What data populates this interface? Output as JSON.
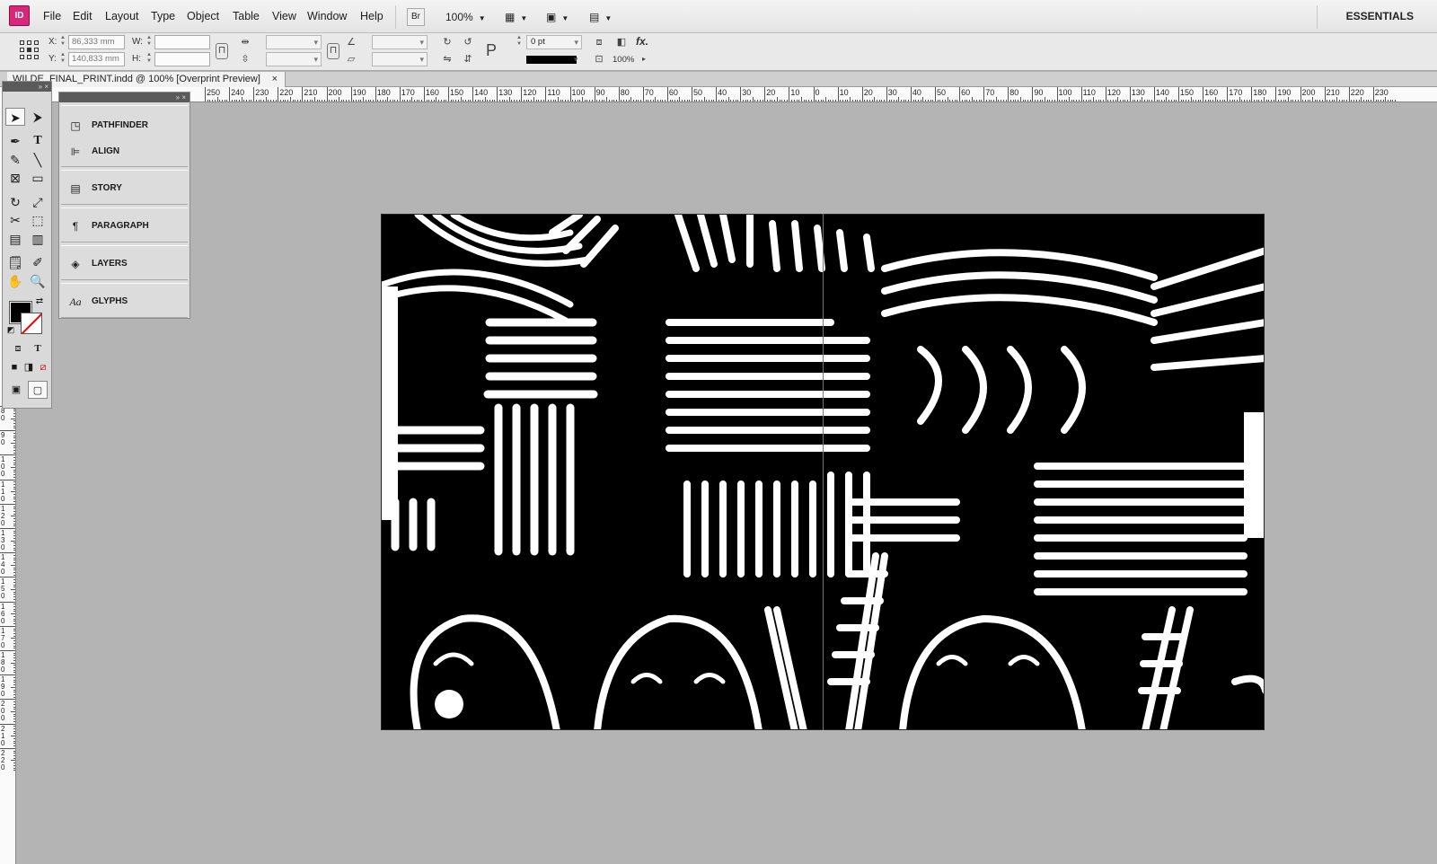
{
  "app": {
    "logo": "ID"
  },
  "menu": [
    "File",
    "Edit",
    "Layout",
    "Type",
    "Object",
    "Table",
    "View",
    "Window",
    "Help"
  ],
  "menubar": {
    "bridge_button": "Br",
    "zoom": "100%",
    "workspace": "ESSENTIALS"
  },
  "control": {
    "x_label": "X:",
    "y_label": "Y:",
    "w_label": "W:",
    "h_label": "H:",
    "x_value": "86,333 mm",
    "y_value": "140,833 mm",
    "w_value": "",
    "h_value": "",
    "stroke_weight": "0 pt",
    "opacity": "100%",
    "fx_label": "fx."
  },
  "document": {
    "tab_title": "WILDE_FINAL_PRINT.indd @ 100% [Overprint Preview]",
    "close_glyph": "×"
  },
  "ruler": {
    "h_labels": [
      "250",
      "240",
      "230",
      "220",
      "210",
      "200",
      "190",
      "180",
      "170",
      "160",
      "150",
      "140",
      "130",
      "120",
      "110",
      "100",
      "90",
      "80",
      "70",
      "60",
      "50",
      "40",
      "30",
      "20",
      "10",
      "0",
      "10",
      "20",
      "30",
      "40",
      "50",
      "60",
      "70",
      "80",
      "90",
      "100",
      "110",
      "120",
      "130",
      "140",
      "150",
      "160",
      "170",
      "180",
      "190",
      "200",
      "210",
      "220",
      "230"
    ],
    "v_labels": [
      "80",
      "90",
      "100",
      "110",
      "120",
      "130",
      "140",
      "150",
      "160",
      "170",
      "180",
      "190",
      "200",
      "210",
      "220"
    ]
  },
  "panels": [
    {
      "label": "PATHFINDER",
      "icon": "pathfinder-icon"
    },
    {
      "label": "ALIGN",
      "icon": "align-icon"
    },
    {
      "label": "STORY",
      "icon": "story-icon"
    },
    {
      "label": "PARAGRAPH",
      "icon": "paragraph-icon"
    },
    {
      "label": "LAYERS",
      "icon": "layers-icon"
    },
    {
      "label": "GLYPHS",
      "icon": "glyphs-icon"
    }
  ],
  "panel_glyphs": {
    "paragraph": "¶",
    "glyphs": "Aa",
    "collapse": "»",
    "close": "×"
  },
  "tools": [
    "selection-tool",
    "direct-selection-tool",
    "pen-tool",
    "type-tool",
    "pencil-tool",
    "line-tool",
    "rectangle-frame-tool",
    "rectangle-tool",
    "rotate-tool",
    "scale-tool",
    "scissors-tool",
    "free-transform-tool",
    "gradient-swatch-tool",
    "gradient-feather-tool",
    "note-tool",
    "eyedropper-tool",
    "hand-tool",
    "zoom-tool"
  ],
  "tool_glyphs": {
    "type": "T",
    "formatting_text": "T"
  },
  "colors": {
    "fill": "#000000",
    "stroke": "none",
    "page_ink": "#000000",
    "pasteboard": "#b4b4b4",
    "app_accent": "#d8267b"
  }
}
